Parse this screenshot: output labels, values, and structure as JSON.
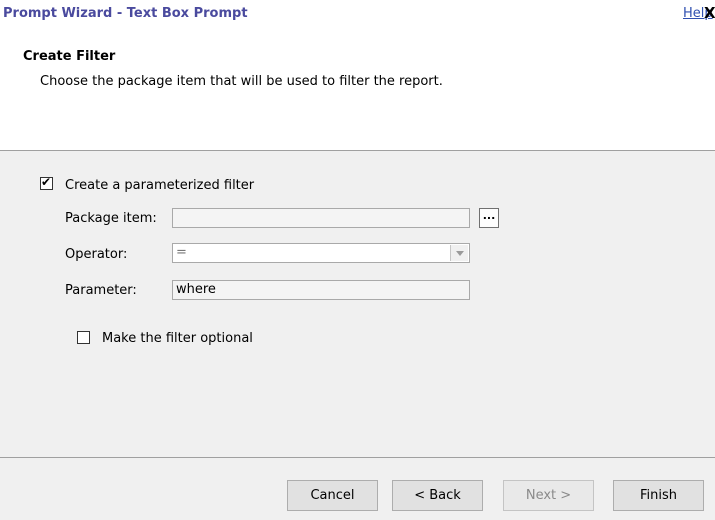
{
  "window": {
    "title": "Prompt Wizard - Text Box Prompt",
    "help_label": "Help",
    "close_glyph": "X"
  },
  "header": {
    "title": "Create Filter",
    "description": "Choose the package item that will be used to filter the report."
  },
  "form": {
    "parameterized_checkbox": {
      "label": "Create a parameterized filter",
      "checked": true,
      "mark": "✔"
    },
    "package_item": {
      "label": "Package item:",
      "value": "",
      "browse_label": "..."
    },
    "operator": {
      "label": "Operator:",
      "value": "="
    },
    "parameter": {
      "label": "Parameter:",
      "value": "where"
    },
    "optional_checkbox": {
      "label": "Make the filter optional",
      "checked": false
    }
  },
  "buttons": {
    "cancel": "Cancel",
    "back": "< Back",
    "next": "Next >",
    "finish": "Finish"
  }
}
